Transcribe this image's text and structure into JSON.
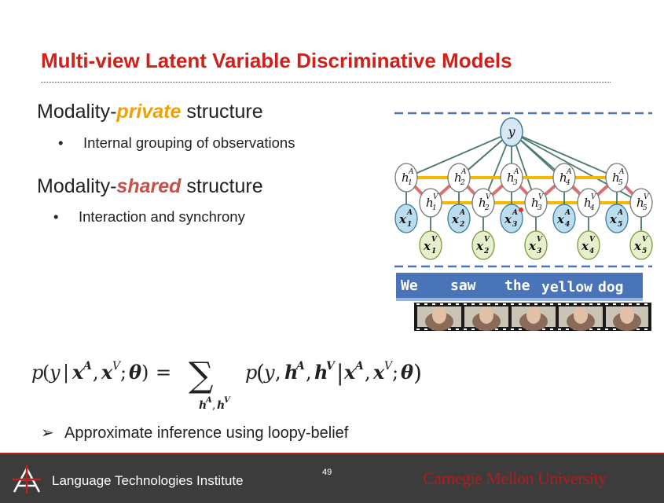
{
  "title": "Multi-view Latent Variable Discriminative Models",
  "sections": [
    {
      "prefix": "Modality-",
      "emphasis": "private",
      "suffix": " structure",
      "emphasis_color": "#f0a000",
      "bullet": "Internal grouping of observations"
    },
    {
      "prefix": "Modality-",
      "emphasis": "shared",
      "suffix": " structure",
      "emphasis_color": "#c8504a",
      "bullet": "Interaction and synchrony"
    }
  ],
  "diagram": {
    "output_node": "y",
    "audio_hidden": [
      "h1A",
      "h2A",
      "h3A",
      "h4A",
      "h5A"
    ],
    "visual_hidden": [
      "h1V",
      "h2V",
      "h3V",
      "h4V",
      "h5V"
    ],
    "audio_obs": [
      "x1A",
      "x2A",
      "x3A",
      "x4A",
      "x5A"
    ],
    "visual_obs": [
      "x1V",
      "x2V",
      "x3V",
      "x4V",
      "x5V"
    ],
    "sentence": [
      "We",
      "saw",
      "the",
      "yellow",
      "dog"
    ],
    "video_frames": 5,
    "colors": {
      "private_edges": "#f5b800",
      "shared_edges": "#d87070",
      "top_edges": "#4a7a6a",
      "audio_obs_fill": "#bcdcf0",
      "visual_obs_fill": "#e6f0cc",
      "caption_bar": "#4a74b8"
    }
  },
  "formula": "p(y | x^A, x^V; θ) = Σ_{h^A,h^V} p(y, h^A, h^V | x^A, x^V; θ)",
  "inference_bullet": "Approximate inference using loopy-belief",
  "footer": {
    "institute": "Language Technologies Institute",
    "page_number": "49",
    "university": "Carnegie Mellon University"
  }
}
